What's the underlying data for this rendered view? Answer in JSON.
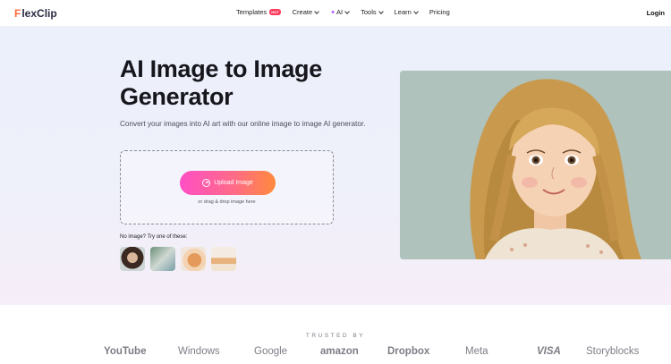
{
  "nav": {
    "logo_mark": "F",
    "logo_text": "lexClip",
    "items": [
      {
        "label": "Templates",
        "badge": "HOT",
        "dropdown": false
      },
      {
        "label": "Create",
        "dropdown": true
      },
      {
        "label": "AI",
        "dropdown": true
      },
      {
        "label": "Tools",
        "dropdown": true
      },
      {
        "label": "Learn",
        "dropdown": true
      },
      {
        "label": "Pricing",
        "dropdown": false
      }
    ],
    "login": "Login"
  },
  "hero": {
    "title": "AI Image to Image Generator",
    "subtitle": "Convert your images into AI art with our online image to image AI generator.",
    "upload_button": "Upload Image",
    "drag_text": "or drag & drop image here",
    "samples_label": "No image? Try one of these:",
    "sample_images": [
      "sample-boy-portrait",
      "sample-landscape",
      "sample-cat",
      "sample-food"
    ]
  },
  "trusted": {
    "label": "TRUSTED BY",
    "brands": [
      "YouTube",
      "Windows",
      "Google",
      "amazon",
      "Dropbox",
      "Meta",
      "VISA",
      "Storyblocks"
    ]
  },
  "colors": {
    "upload_gradient_start": "#ff4fc4",
    "upload_gradient_end": "#ff8a3c",
    "badge": "#ff3b5c",
    "logo_accent": "#ff6a3d"
  }
}
